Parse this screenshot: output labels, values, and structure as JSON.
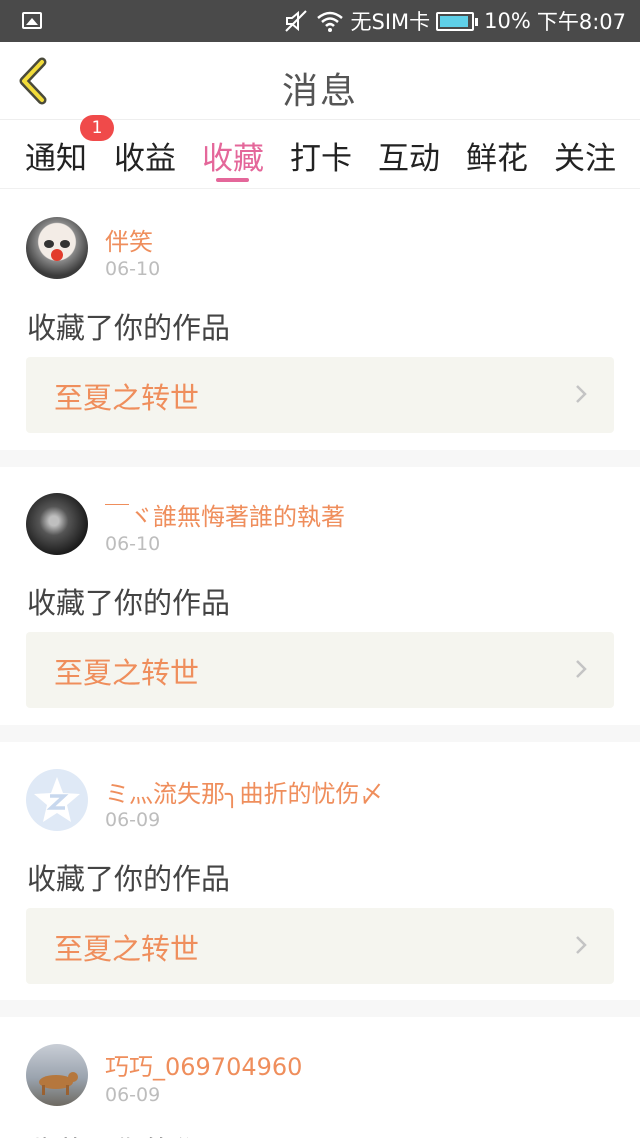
{
  "status_bar": {
    "carrier": "无SIM卡",
    "battery": "10%",
    "time": "下午8:07"
  },
  "header": {
    "title": "消息"
  },
  "tabs": [
    {
      "label": "通知",
      "badge": "1"
    },
    {
      "label": "收益"
    },
    {
      "label": "收藏",
      "active": true
    },
    {
      "label": "打卡"
    },
    {
      "label": "互动"
    },
    {
      "label": "鲜花"
    },
    {
      "label": "关注"
    }
  ],
  "messages": [
    {
      "sender": "伴笑",
      "date": "06-10",
      "text": "收藏了你的作品",
      "work": "至夏之转世"
    },
    {
      "sender": "￣ヾ誰無悔著誰的執著",
      "date": "06-10",
      "text": "收藏了你的作品",
      "work": "至夏之转世"
    },
    {
      "sender": "ミ灬流失那╮曲折的忧伤〆",
      "date": "06-09",
      "text": "收藏了你的作品",
      "work": "至夏之转世"
    },
    {
      "sender": "巧巧_069704960",
      "date": "06-09",
      "text": "收藏了你的作品"
    }
  ],
  "colors": {
    "accent_pink": "#e4679a",
    "accent_orange": "#ef8e5c",
    "badge_red": "#f04a4a"
  }
}
